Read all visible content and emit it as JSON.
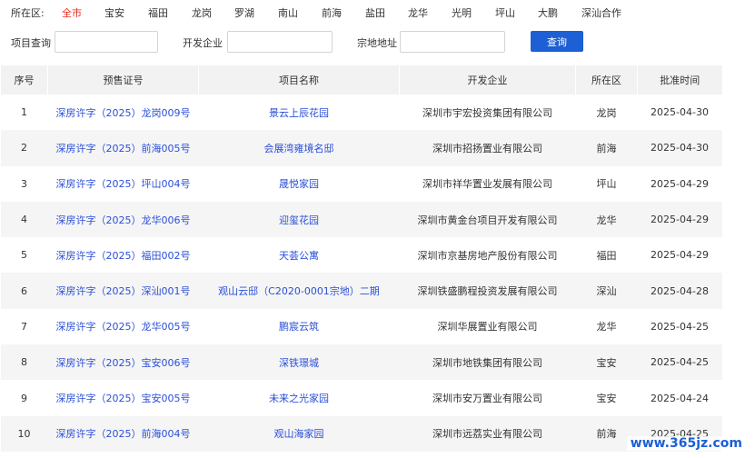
{
  "districts": {
    "label": "所在区:",
    "items": [
      "全市",
      "宝安",
      "福田",
      "龙岗",
      "罗湖",
      "南山",
      "前海",
      "盐田",
      "龙华",
      "光明",
      "坪山",
      "大鹏",
      "深汕合作"
    ],
    "active": "全市"
  },
  "search": {
    "project_label": "项目查询",
    "project_value": "",
    "developer_label": "开发企业",
    "developer_value": "",
    "land_label": "宗地地址",
    "land_value": "",
    "button_label": "查询"
  },
  "table": {
    "headers": [
      "序号",
      "预售证号",
      "项目名称",
      "开发企业",
      "所在区",
      "批准时间"
    ],
    "rows": [
      {
        "no": "1",
        "permit": "深房许字（2025）龙岗009号",
        "project": "景云上辰花园",
        "developer": "深圳市宇宏投资集团有限公司",
        "district": "龙岗",
        "date": "2025-04-30"
      },
      {
        "no": "2",
        "permit": "深房许字（2025）前海005号",
        "project": "会展湾雍境名邸",
        "developer": "深圳市招扬置业有限公司",
        "district": "前海",
        "date": "2025-04-30"
      },
      {
        "no": "3",
        "permit": "深房许字（2025）坪山004号",
        "project": "晟悦家园",
        "developer": "深圳市祥华置业发展有限公司",
        "district": "坪山",
        "date": "2025-04-29"
      },
      {
        "no": "4",
        "permit": "深房许字（2025）龙华006号",
        "project": "迎玺花园",
        "developer": "深圳市黄金台项目开发有限公司",
        "district": "龙华",
        "date": "2025-04-29"
      },
      {
        "no": "5",
        "permit": "深房许字（2025）福田002号",
        "project": "天荟公寓",
        "developer": "深圳市京基房地产股份有限公司",
        "district": "福田",
        "date": "2025-04-29"
      },
      {
        "no": "6",
        "permit": "深房许字（2025）深汕001号",
        "project": "观山云邸（C2020-0001宗地）二期",
        "developer": "深圳铁盛鹏程投资发展有限公司",
        "district": "深汕",
        "date": "2025-04-28"
      },
      {
        "no": "7",
        "permit": "深房许字（2025）龙华005号",
        "project": "鹏宸云筑",
        "developer": "深圳华展置业有限公司",
        "district": "龙华",
        "date": "2025-04-25"
      },
      {
        "no": "8",
        "permit": "深房许字（2025）宝安006号",
        "project": "深铁璟城",
        "developer": "深圳市地铁集团有限公司",
        "district": "宝安",
        "date": "2025-04-25"
      },
      {
        "no": "9",
        "permit": "深房许字（2025）宝安005号",
        "project": "未来之光家园",
        "developer": "深圳市安万置业有限公司",
        "district": "宝安",
        "date": "2025-04-24"
      },
      {
        "no": "10",
        "permit": "深房许字（2025）前海004号",
        "project": "观山海家园",
        "developer": "深圳市远荔实业有限公司",
        "district": "前海",
        "date": "2025-04-25"
      }
    ]
  },
  "watermark": "www.365jz.com"
}
